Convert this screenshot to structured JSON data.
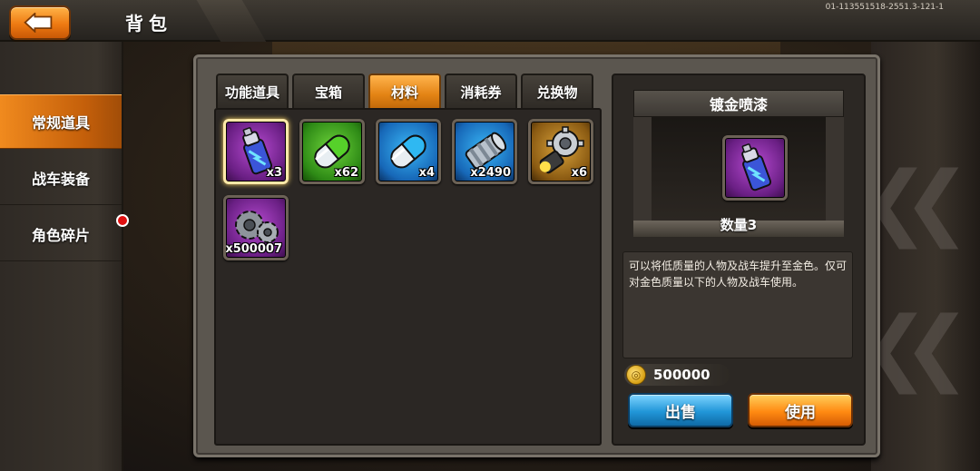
{
  "header": {
    "title": "背包",
    "build_id": "01-113551518-2551.3-121-1"
  },
  "sidebar": {
    "items": [
      {
        "label": "常规道具",
        "active": true
      },
      {
        "label": "战车装备",
        "active": false
      },
      {
        "label": "角色碎片",
        "active": false,
        "badge": "red-dot"
      }
    ]
  },
  "tabs": [
    {
      "label": "功能道具",
      "active": false
    },
    {
      "label": "宝箱",
      "active": false
    },
    {
      "label": "材料",
      "active": true
    },
    {
      "label": "消耗券",
      "active": false
    },
    {
      "label": "兑换物",
      "active": false
    }
  ],
  "items": [
    {
      "icon": "spray-can-icon",
      "rarity": "purple",
      "quantity": "x3",
      "selected": true
    },
    {
      "icon": "green-capsule-icon",
      "rarity": "green",
      "quantity": "x62",
      "selected": false
    },
    {
      "icon": "blue-capsule-icon",
      "rarity": "blue",
      "quantity": "x4",
      "selected": false
    },
    {
      "icon": "metal-cylinder-icon",
      "rarity": "blue",
      "quantity": "x2490",
      "selected": false
    },
    {
      "icon": "gear-part-icon",
      "rarity": "gold",
      "quantity": "x6",
      "selected": false
    },
    {
      "icon": "gears-icon",
      "rarity": "purple",
      "quantity": "x500007",
      "selected": false
    }
  ],
  "detail": {
    "name": "镀金喷漆",
    "icon": "spray-can-icon",
    "quantity_label": "数量3",
    "description": "可以将低质量的人物及战车提升至金色。仅可对金色质量以下的人物及战车使用。",
    "price": "500000",
    "sell_label": "出售",
    "use_label": "使用"
  },
  "colors": {
    "accent_orange": "#f08a1e",
    "sell_blue": "#2196d8",
    "use_orange": "#ff8a12",
    "rarity_purple": "#8a2aa6",
    "rarity_green": "#2e8a16",
    "rarity_blue": "#1768b8",
    "rarity_gold": "#b07a1c"
  }
}
